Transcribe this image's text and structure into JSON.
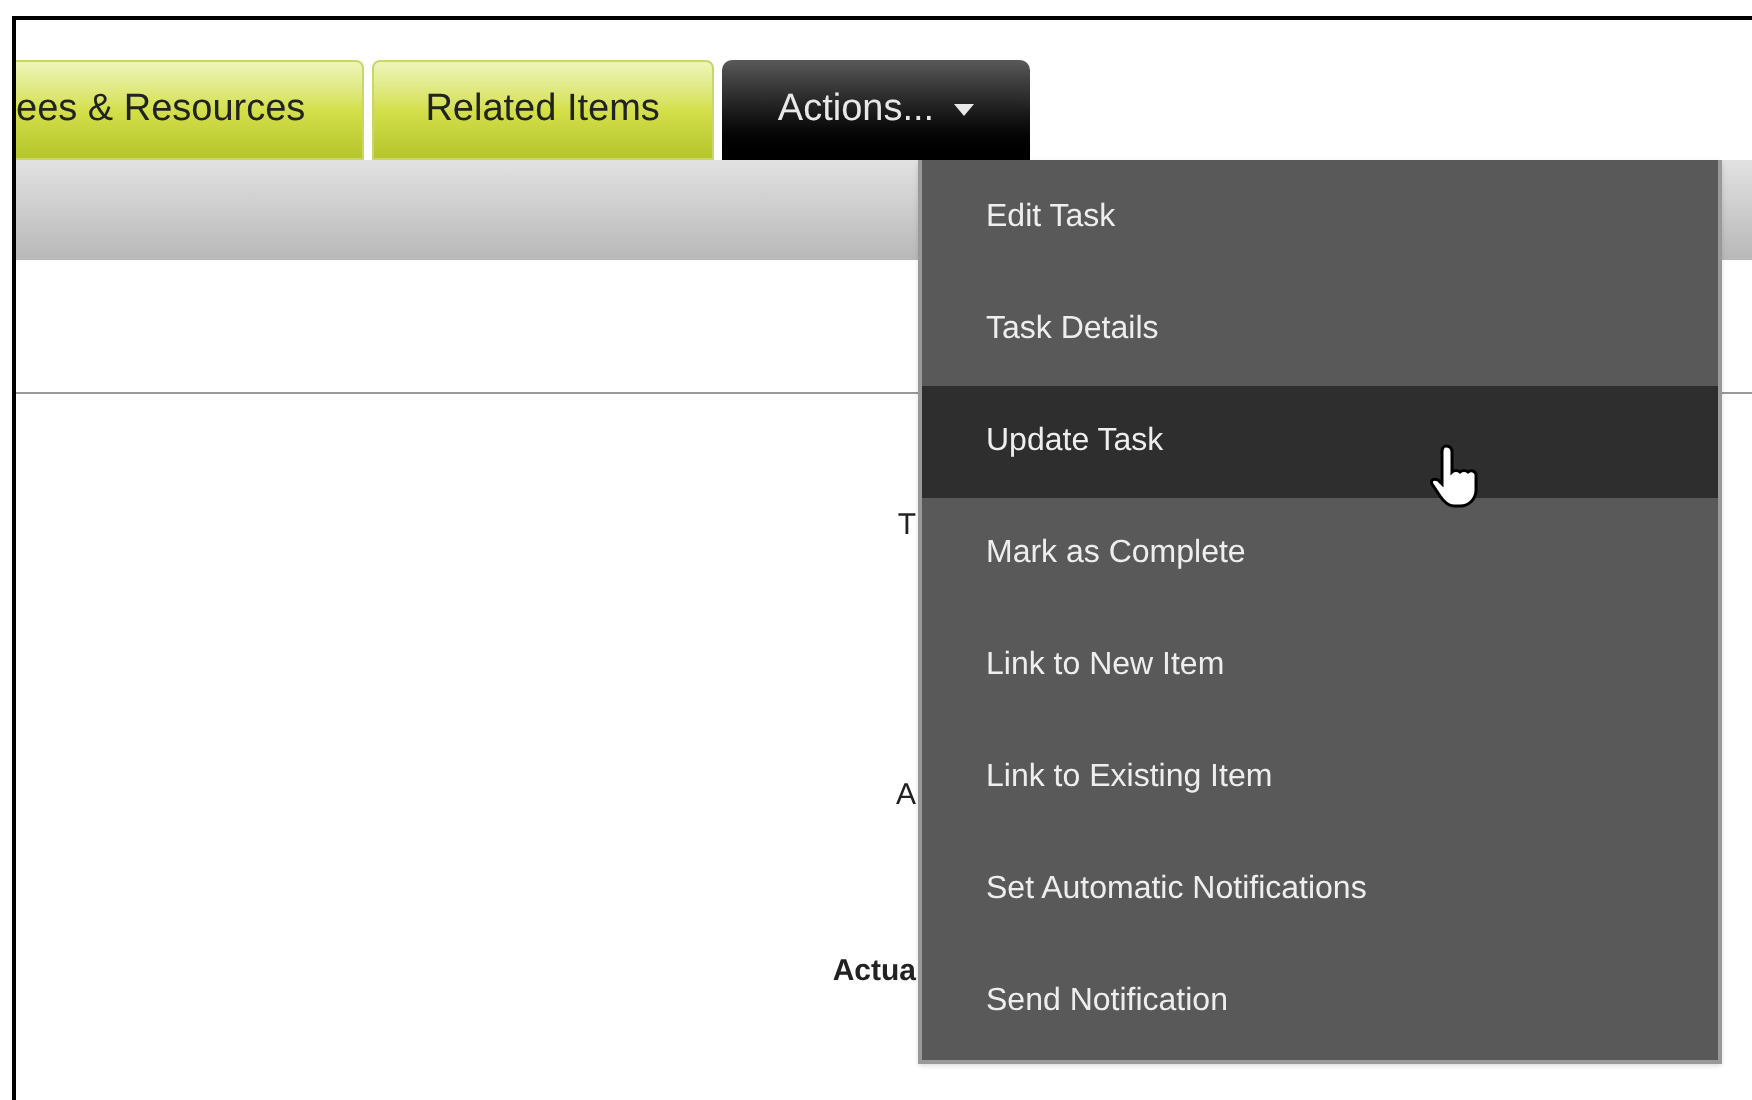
{
  "tabs": [
    {
      "label": "ees & Resources",
      "selected": false
    },
    {
      "label": "Related Items",
      "selected": false
    },
    {
      "label": "Actions...",
      "selected": true
    }
  ],
  "actions_menu": {
    "items": [
      {
        "label": "Edit Task",
        "selected": false
      },
      {
        "label": "Task Details",
        "selected": false
      },
      {
        "label": "Update Task",
        "selected": true
      },
      {
        "label": "Mark as Complete",
        "selected": false
      },
      {
        "label": "Link to New Item",
        "selected": false
      },
      {
        "label": "Link to Existing Item",
        "selected": false
      },
      {
        "label": "Set Automatic Notifications",
        "selected": false
      },
      {
        "label": "Send Notification",
        "selected": false
      }
    ]
  },
  "form_labels": [
    {
      "label": "T",
      "bold": false
    },
    {
      "label": "A",
      "bold": false
    },
    {
      "label": "Actua",
      "bold": true
    }
  ]
}
